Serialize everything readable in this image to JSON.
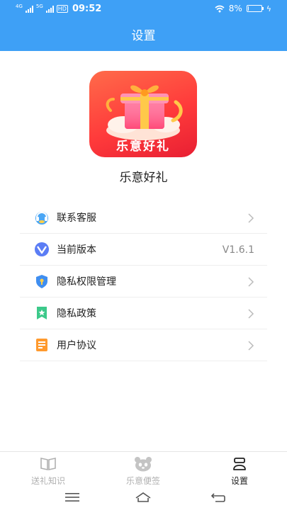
{
  "status_bar": {
    "net_4g": "4G",
    "net_5g": "5G",
    "hd": "HD",
    "time": "09:52",
    "battery_text": "8%",
    "battery_level": 0.08
  },
  "header": {
    "title": "设置"
  },
  "app": {
    "logo_text": "乐意好礼",
    "name": "乐意好礼"
  },
  "settings": [
    {
      "label": "联系客服",
      "icon": "headset-icon",
      "value": ""
    },
    {
      "label": "当前版本",
      "icon": "version-icon",
      "value": "V1.6.1"
    },
    {
      "label": "隐私权限管理",
      "icon": "shield-icon",
      "value": ""
    },
    {
      "label": "隐私政策",
      "icon": "bookmark-star-icon",
      "value": ""
    },
    {
      "label": "用户协议",
      "icon": "document-icon",
      "value": ""
    }
  ],
  "tabs": [
    {
      "label": "送礼知识",
      "icon": "book-icon",
      "active": false
    },
    {
      "label": "乐意便签",
      "icon": "panda-icon",
      "active": false
    },
    {
      "label": "设置",
      "icon": "settings-person-icon",
      "active": true
    }
  ],
  "colors": {
    "primary": "#3ea0f6",
    "logo_red": "#ff3b3b",
    "text": "#222222",
    "muted": "#b0b0b0"
  }
}
